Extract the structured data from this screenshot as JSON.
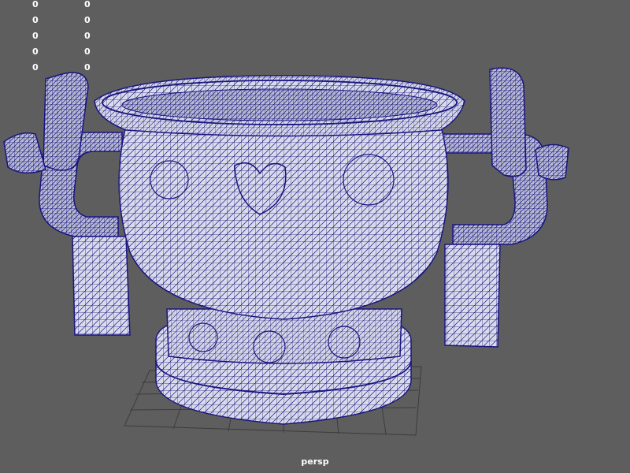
{
  "hud": {
    "rows": [
      {
        "col1": "0",
        "col2": "0"
      },
      {
        "col1": "0",
        "col2": "0"
      },
      {
        "col1": "0",
        "col2": "0"
      },
      {
        "col1": "0",
        "col2": "0"
      },
      {
        "col1": "0",
        "col2": "0"
      }
    ]
  },
  "viewport": {
    "camera_label": "persp",
    "background_color": "#5e5e5e",
    "wire_color": "#1a1580",
    "surface_color": "#d9dbea"
  },
  "model": {
    "icon": "wireframe-vessel-icon"
  }
}
